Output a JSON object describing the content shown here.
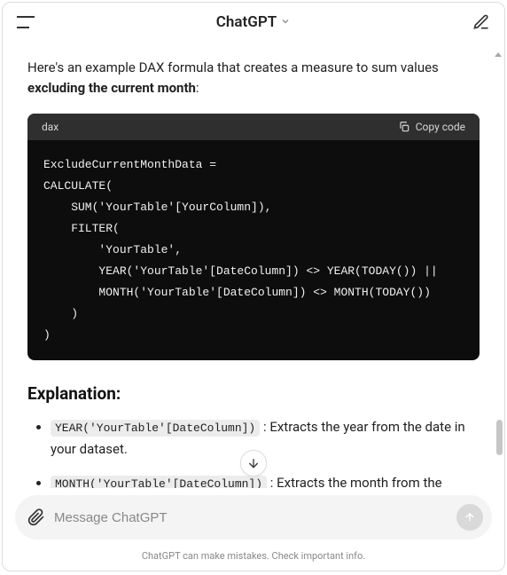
{
  "header": {
    "title": "ChatGPT"
  },
  "message": {
    "intro_prefix": "Here's an example DAX formula that creates a measure to sum values ",
    "intro_strong": "excluding the current month",
    "intro_suffix": ":",
    "code_lang": "dax",
    "copy_label": "Copy code",
    "code_lines": [
      "ExcludeCurrentMonthData =",
      "CALCULATE(",
      "    SUM('YourTable'[YourColumn]),",
      "    FILTER(",
      "        'YourTable',",
      "        YEAR('YourTable'[DateColumn]) <> YEAR(TODAY()) ||",
      "        MONTH('YourTable'[DateColumn]) <> MONTH(TODAY())",
      "    )",
      ")"
    ],
    "explanation_heading": "Explanation:",
    "explanation": [
      {
        "code": "YEAR('YourTable'[DateColumn])",
        "text": ": Extracts the year from the date in your dataset."
      },
      {
        "code": "MONTH('YourTable'[DateColumn])",
        "text": ": Extracts the month from the"
      }
    ]
  },
  "input": {
    "placeholder": "Message ChatGPT"
  },
  "footer": {
    "disclaimer": "ChatGPT can make mistakes. Check important info."
  }
}
